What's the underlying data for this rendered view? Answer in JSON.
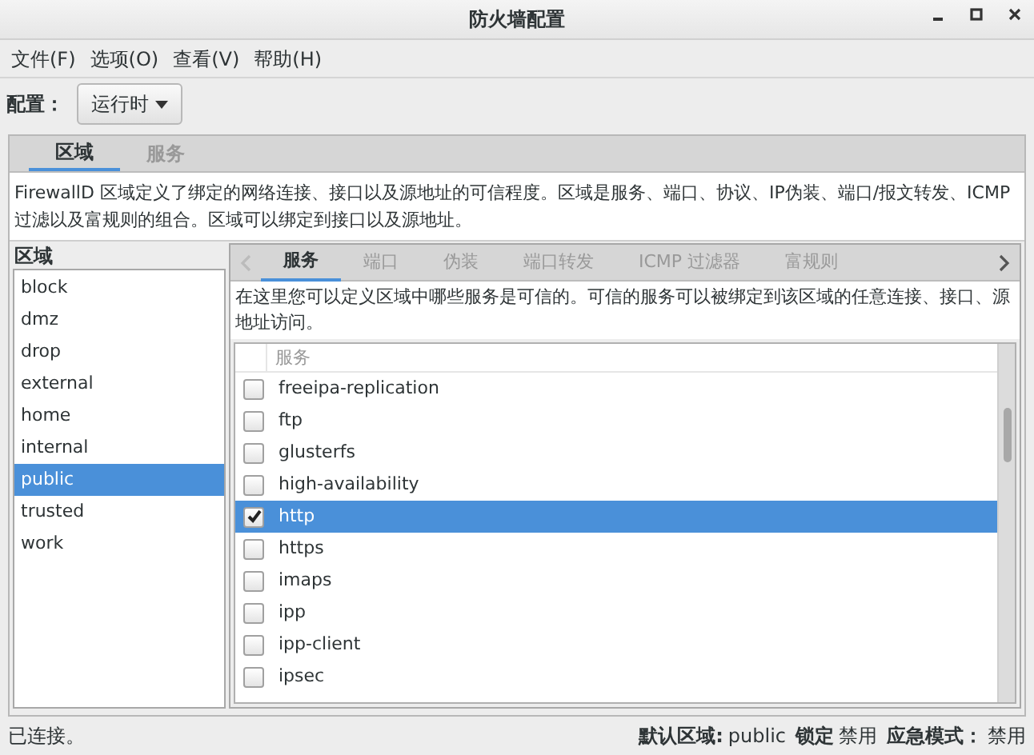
{
  "window": {
    "title": "防火墙配置"
  },
  "menu": [
    "文件(F)",
    "选项(O)",
    "查看(V)",
    "帮助(H)"
  ],
  "config": {
    "label": "配置：",
    "value": "运行时"
  },
  "tabs": [
    {
      "label": "区域",
      "selected": true
    },
    {
      "label": "服务",
      "selected": false
    }
  ],
  "description": "FirewallD 区域定义了绑定的网络连接、接口以及源地址的可信程度。区域是服务、端口、协议、IP伪装、端口/报文转发、ICMP 过滤以及富规则的组合。区域可以绑定到接口以及源地址。",
  "zones": {
    "heading": "区域",
    "items": [
      {
        "name": "block",
        "selected": false
      },
      {
        "name": "dmz",
        "selected": false
      },
      {
        "name": "drop",
        "selected": false
      },
      {
        "name": "external",
        "selected": false
      },
      {
        "name": "home",
        "selected": false
      },
      {
        "name": "internal",
        "selected": false
      },
      {
        "name": "public",
        "selected": true
      },
      {
        "name": "trusted",
        "selected": false
      },
      {
        "name": "work",
        "selected": false
      }
    ]
  },
  "zone_tabs": [
    {
      "label": "服务",
      "selected": true
    },
    {
      "label": "端口",
      "selected": false
    },
    {
      "label": "伪装",
      "selected": false
    },
    {
      "label": "端口转发",
      "selected": false
    },
    {
      "label": "ICMP 过滤器",
      "selected": false
    },
    {
      "label": "富规则",
      "selected": false
    }
  ],
  "services": {
    "description": "在这里您可以定义区域中哪些服务是可信的。可信的服务可以被绑定到该区域的任意连接、接口、源地址访问。",
    "column": "服务",
    "rows": [
      {
        "name": "freeipa-replication",
        "checked": false,
        "selected": false
      },
      {
        "name": "ftp",
        "checked": false,
        "selected": false
      },
      {
        "name": "glusterfs",
        "checked": false,
        "selected": false
      },
      {
        "name": "high-availability",
        "checked": false,
        "selected": false
      },
      {
        "name": "http",
        "checked": true,
        "selected": true
      },
      {
        "name": "https",
        "checked": false,
        "selected": false
      },
      {
        "name": "imaps",
        "checked": false,
        "selected": false
      },
      {
        "name": "ipp",
        "checked": false,
        "selected": false
      },
      {
        "name": "ipp-client",
        "checked": false,
        "selected": false
      },
      {
        "name": "ipsec",
        "checked": false,
        "selected": false
      }
    ]
  },
  "status_bar": {
    "connection": "已连接。",
    "fields": [
      {
        "label": "默认区域:",
        "value": "public"
      },
      {
        "label": "锁定",
        "value": "禁用"
      },
      {
        "label": "应急模式：",
        "value": "禁用"
      }
    ]
  }
}
